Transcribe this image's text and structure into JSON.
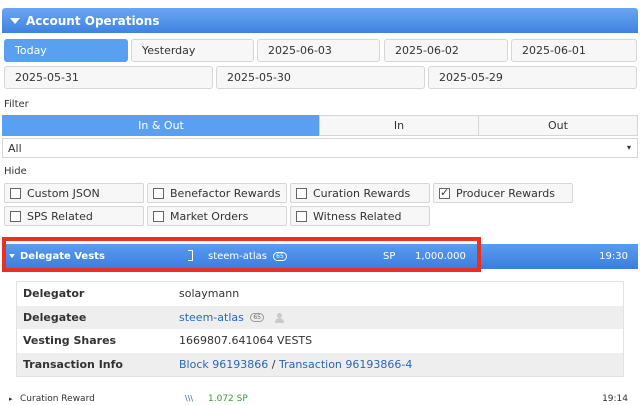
{
  "header": {
    "title": "Account Operations"
  },
  "dates": {
    "row1": [
      "Today",
      "Yesterday",
      "2025-06-03",
      "2025-06-02",
      "2025-06-01"
    ],
    "row2": [
      "2025-05-31",
      "2025-05-30",
      "2025-05-29"
    ]
  },
  "filter": {
    "label": "Filter",
    "segments": [
      "In & Out",
      "In",
      "Out"
    ],
    "select_value": "All"
  },
  "hide": {
    "label": "Hide",
    "options": [
      {
        "label": "Custom JSON",
        "checked": false
      },
      {
        "label": "Benefactor Rewards",
        "checked": false
      },
      {
        "label": "Curation Rewards",
        "checked": false
      },
      {
        "label": "Producer Rewards",
        "checked": true
      },
      {
        "label": "SPS Related",
        "checked": false
      },
      {
        "label": "Market Orders",
        "checked": false
      },
      {
        "label": "Witness Related",
        "checked": false
      }
    ]
  },
  "operation": {
    "type": "Delegate Vests",
    "account": "steem-atlas",
    "account_rep": "65",
    "unit": "SP",
    "amount": "1,000.000",
    "time": "19:30"
  },
  "details": {
    "delegator_label": "Delegator",
    "delegator": "solaymann",
    "delegatee_label": "Delegatee",
    "delegatee": "steem-atlas",
    "delegatee_rep": "65",
    "vesting_label": "Vesting Shares",
    "vesting": "1669807.641064 VESTS",
    "tx_label": "Transaction Info",
    "block": "Block 96193866",
    "sep": "/",
    "transaction": "Transaction 96193866-4"
  },
  "next_op": {
    "type": "Curation Reward",
    "amount": "1.072 SP",
    "time": "19:14"
  }
}
